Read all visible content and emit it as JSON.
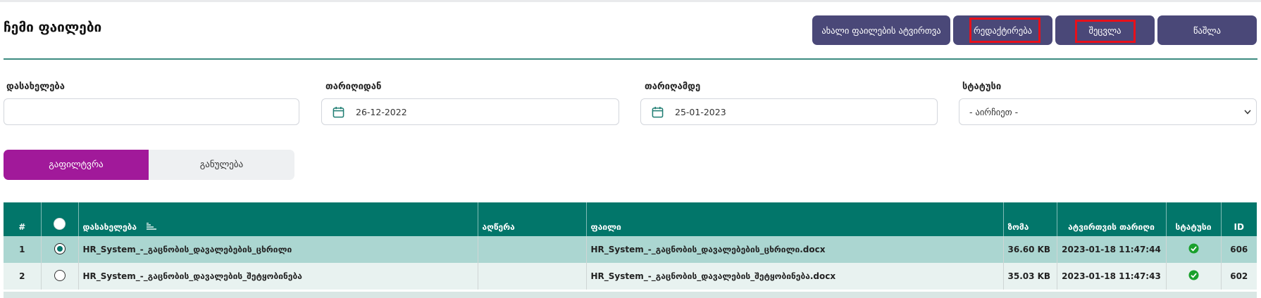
{
  "header": {
    "title": "ჩემი ფაილები",
    "buttons": {
      "upload": "ახალი ფაილების ატვირთვა",
      "edit": "რედაქტირება",
      "change": "შეცვლა",
      "delete": "წაშლა"
    }
  },
  "filters": {
    "name_label": "დასახელება",
    "name_value": "",
    "date_from_label": "თარიღიდან",
    "date_from_value": "26-12-2022",
    "date_to_label": "თარიღამდე",
    "date_to_value": "25-01-2023",
    "status_label": "სტატუსი",
    "status_selected": "- აირჩიეთ -",
    "filter_button": "გაფილტვრა",
    "reset_button": "განულება"
  },
  "table": {
    "headers": {
      "num": "#",
      "name": "დასახელება",
      "description": "აღწერა",
      "file": "ფაილი",
      "size": "ზომა",
      "upload_date": "ატვირთვის თარიღი",
      "status": "სტატუსი",
      "id": "ID"
    },
    "rows": [
      {
        "num": "1",
        "selected": true,
        "name": "HR_System_-_გაცნობის_დავალებების_ცხრილი",
        "description": "",
        "file": "HR_System_-_გაცნობის_დავალებების_ცხრილი.docx",
        "size": "36.60 KB",
        "upload_date": "2023-01-18 11:47:44",
        "status": "approved",
        "id": "606"
      },
      {
        "num": "2",
        "selected": false,
        "name": "HR_System_-_გაცნობის_დავალების_შეტყობინება",
        "description": "",
        "file": "HR_System_-_გაცნობის_დავალების_შეტყობინება.docx",
        "size": "35.03 KB",
        "upload_date": "2023-01-18 11:47:43",
        "status": "approved",
        "id": "602"
      }
    ]
  },
  "colors": {
    "accent": "#02766a",
    "button": "#4a4878",
    "filter_button": "#a1199a",
    "highlight": "#e8101a"
  }
}
